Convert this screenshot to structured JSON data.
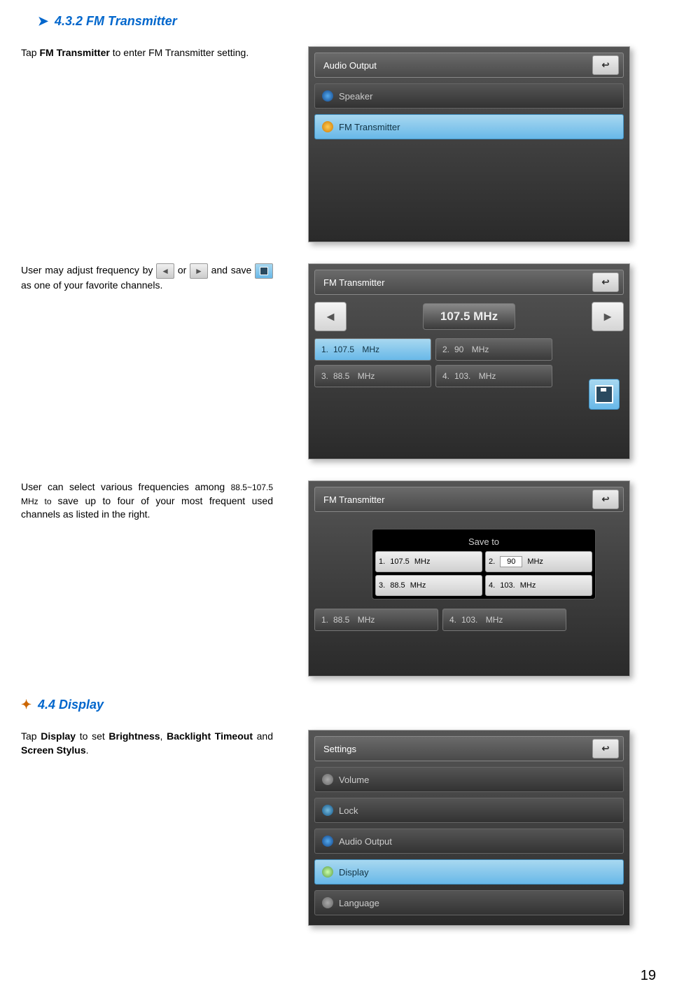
{
  "section_4_3_2": {
    "heading": "4.3.2 FM Transmitter",
    "para1_pre": "Tap ",
    "para1_bold": "FM Transmitter",
    "para1_post": " to enter FM Transmitter setting.",
    "para2_pre": "User may adjust frequency by ",
    "para2_mid1": " or ",
    "para2_mid2": " and save ",
    "para2_post": " as one of your favorite channels.",
    "para3_pre": "User can select various frequencies among ",
    "para3_range": "88.5~107.5 MHz to ",
    "para3_mid": "save up to four of your ",
    "para3_post": "most frequent used channels as listed in the right."
  },
  "section_4_4": {
    "heading": "4.4 Display",
    "para_pre": "Tap ",
    "para_b1": "Display",
    "para_m1": " to set ",
    "para_b2": "Brightness",
    "para_m2": ", ",
    "para_b3": "Backlight Timeout",
    "para_m3": " and ",
    "para_b4": "Screen Stylus",
    "para_post": "."
  },
  "screen1": {
    "title": "Audio Output",
    "back": "↩",
    "items": [
      "Speaker",
      "FM Transmitter"
    ]
  },
  "screen2": {
    "title": "FM Transmitter",
    "back": "↩",
    "current_freq": "107.5 MHz",
    "presets": [
      {
        "n": "1.",
        "v": "107.5",
        "u": "MHz"
      },
      {
        "n": "2.",
        "v": "90",
        "u": "MHz"
      },
      {
        "n": "3.",
        "v": "88.5",
        "u": "MHz"
      },
      {
        "n": "4.",
        "v": "103.",
        "u": "MHz"
      }
    ]
  },
  "screen3": {
    "title": "FM Transmitter",
    "back": "↩",
    "popup_title": "Save to",
    "popup": [
      {
        "n": "1.",
        "v": "107.5",
        "u": "MHz"
      },
      {
        "n": "2.",
        "v": "90",
        "u": "MHz",
        "edit": true
      },
      {
        "n": "3.",
        "v": "88.5",
        "u": "MHz"
      },
      {
        "n": "4.",
        "v": "103.",
        "u": "MHz"
      }
    ],
    "bg_presets": [
      {
        "n": "1.",
        "v": "88.5",
        "u": "MHz"
      },
      {
        "n": "4.",
        "v": "103.",
        "u": "MHz"
      }
    ]
  },
  "screen4": {
    "title": "Settings",
    "back": "↩",
    "items": [
      "Volume",
      "Lock",
      "Audio Output",
      "Display",
      "Language"
    ]
  },
  "page_number": "19"
}
